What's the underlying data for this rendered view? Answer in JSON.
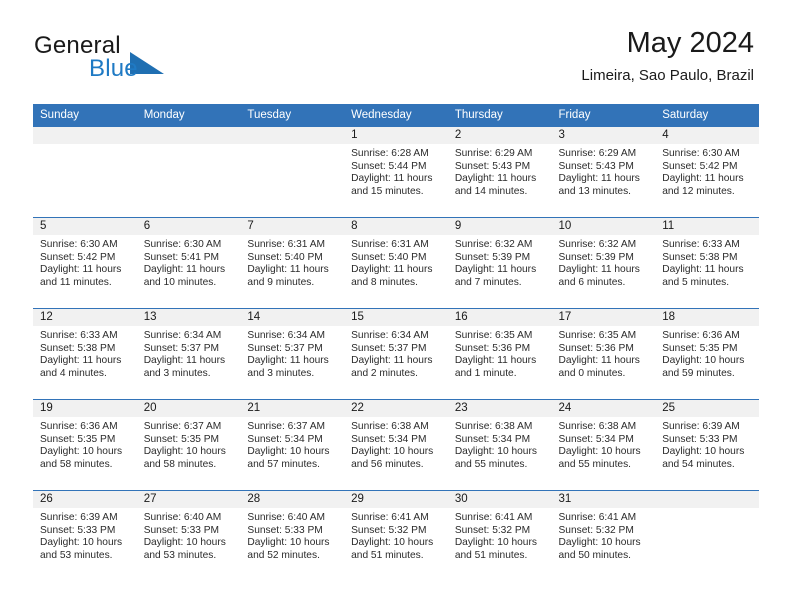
{
  "brand": {
    "name_part1": "General",
    "name_part2": "Blue",
    "logo_icon": "triangle-logo-icon"
  },
  "header": {
    "month_title": "May 2024",
    "location": "Limeira, Sao Paulo, Brazil"
  },
  "colors": {
    "header_blue": "#3273b8",
    "brand_blue": "#1f7ac4",
    "date_strip_gray": "#f1f1f1",
    "text": "#1a1a1a"
  },
  "weekday_headers": [
    "Sunday",
    "Monday",
    "Tuesday",
    "Wednesday",
    "Thursday",
    "Friday",
    "Saturday"
  ],
  "weeks": [
    [
      {
        "date": "",
        "empty": true,
        "sunrise": "",
        "sunset": "",
        "daylight_line1": "",
        "daylight_line2": ""
      },
      {
        "date": "",
        "empty": true,
        "sunrise": "",
        "sunset": "",
        "daylight_line1": "",
        "daylight_line2": ""
      },
      {
        "date": "",
        "empty": true,
        "sunrise": "",
        "sunset": "",
        "daylight_line1": "",
        "daylight_line2": ""
      },
      {
        "date": "1",
        "empty": false,
        "sunrise": "Sunrise: 6:28 AM",
        "sunset": "Sunset: 5:44 PM",
        "daylight_line1": "Daylight: 11 hours",
        "daylight_line2": "and 15 minutes."
      },
      {
        "date": "2",
        "empty": false,
        "sunrise": "Sunrise: 6:29 AM",
        "sunset": "Sunset: 5:43 PM",
        "daylight_line1": "Daylight: 11 hours",
        "daylight_line2": "and 14 minutes."
      },
      {
        "date": "3",
        "empty": false,
        "sunrise": "Sunrise: 6:29 AM",
        "sunset": "Sunset: 5:43 PM",
        "daylight_line1": "Daylight: 11 hours",
        "daylight_line2": "and 13 minutes."
      },
      {
        "date": "4",
        "empty": false,
        "sunrise": "Sunrise: 6:30 AM",
        "sunset": "Sunset: 5:42 PM",
        "daylight_line1": "Daylight: 11 hours",
        "daylight_line2": "and 12 minutes."
      }
    ],
    [
      {
        "date": "5",
        "empty": false,
        "sunrise": "Sunrise: 6:30 AM",
        "sunset": "Sunset: 5:42 PM",
        "daylight_line1": "Daylight: 11 hours",
        "daylight_line2": "and 11 minutes."
      },
      {
        "date": "6",
        "empty": false,
        "sunrise": "Sunrise: 6:30 AM",
        "sunset": "Sunset: 5:41 PM",
        "daylight_line1": "Daylight: 11 hours",
        "daylight_line2": "and 10 minutes."
      },
      {
        "date": "7",
        "empty": false,
        "sunrise": "Sunrise: 6:31 AM",
        "sunset": "Sunset: 5:40 PM",
        "daylight_line1": "Daylight: 11 hours",
        "daylight_line2": "and 9 minutes."
      },
      {
        "date": "8",
        "empty": false,
        "sunrise": "Sunrise: 6:31 AM",
        "sunset": "Sunset: 5:40 PM",
        "daylight_line1": "Daylight: 11 hours",
        "daylight_line2": "and 8 minutes."
      },
      {
        "date": "9",
        "empty": false,
        "sunrise": "Sunrise: 6:32 AM",
        "sunset": "Sunset: 5:39 PM",
        "daylight_line1": "Daylight: 11 hours",
        "daylight_line2": "and 7 minutes."
      },
      {
        "date": "10",
        "empty": false,
        "sunrise": "Sunrise: 6:32 AM",
        "sunset": "Sunset: 5:39 PM",
        "daylight_line1": "Daylight: 11 hours",
        "daylight_line2": "and 6 minutes."
      },
      {
        "date": "11",
        "empty": false,
        "sunrise": "Sunrise: 6:33 AM",
        "sunset": "Sunset: 5:38 PM",
        "daylight_line1": "Daylight: 11 hours",
        "daylight_line2": "and 5 minutes."
      }
    ],
    [
      {
        "date": "12",
        "empty": false,
        "sunrise": "Sunrise: 6:33 AM",
        "sunset": "Sunset: 5:38 PM",
        "daylight_line1": "Daylight: 11 hours",
        "daylight_line2": "and 4 minutes."
      },
      {
        "date": "13",
        "empty": false,
        "sunrise": "Sunrise: 6:34 AM",
        "sunset": "Sunset: 5:37 PM",
        "daylight_line1": "Daylight: 11 hours",
        "daylight_line2": "and 3 minutes."
      },
      {
        "date": "14",
        "empty": false,
        "sunrise": "Sunrise: 6:34 AM",
        "sunset": "Sunset: 5:37 PM",
        "daylight_line1": "Daylight: 11 hours",
        "daylight_line2": "and 3 minutes."
      },
      {
        "date": "15",
        "empty": false,
        "sunrise": "Sunrise: 6:34 AM",
        "sunset": "Sunset: 5:37 PM",
        "daylight_line1": "Daylight: 11 hours",
        "daylight_line2": "and 2 minutes."
      },
      {
        "date": "16",
        "empty": false,
        "sunrise": "Sunrise: 6:35 AM",
        "sunset": "Sunset: 5:36 PM",
        "daylight_line1": "Daylight: 11 hours",
        "daylight_line2": "and 1 minute."
      },
      {
        "date": "17",
        "empty": false,
        "sunrise": "Sunrise: 6:35 AM",
        "sunset": "Sunset: 5:36 PM",
        "daylight_line1": "Daylight: 11 hours",
        "daylight_line2": "and 0 minutes."
      },
      {
        "date": "18",
        "empty": false,
        "sunrise": "Sunrise: 6:36 AM",
        "sunset": "Sunset: 5:35 PM",
        "daylight_line1": "Daylight: 10 hours",
        "daylight_line2": "and 59 minutes."
      }
    ],
    [
      {
        "date": "19",
        "empty": false,
        "sunrise": "Sunrise: 6:36 AM",
        "sunset": "Sunset: 5:35 PM",
        "daylight_line1": "Daylight: 10 hours",
        "daylight_line2": "and 58 minutes."
      },
      {
        "date": "20",
        "empty": false,
        "sunrise": "Sunrise: 6:37 AM",
        "sunset": "Sunset: 5:35 PM",
        "daylight_line1": "Daylight: 10 hours",
        "daylight_line2": "and 58 minutes."
      },
      {
        "date": "21",
        "empty": false,
        "sunrise": "Sunrise: 6:37 AM",
        "sunset": "Sunset: 5:34 PM",
        "daylight_line1": "Daylight: 10 hours",
        "daylight_line2": "and 57 minutes."
      },
      {
        "date": "22",
        "empty": false,
        "sunrise": "Sunrise: 6:38 AM",
        "sunset": "Sunset: 5:34 PM",
        "daylight_line1": "Daylight: 10 hours",
        "daylight_line2": "and 56 minutes."
      },
      {
        "date": "23",
        "empty": false,
        "sunrise": "Sunrise: 6:38 AM",
        "sunset": "Sunset: 5:34 PM",
        "daylight_line1": "Daylight: 10 hours",
        "daylight_line2": "and 55 minutes."
      },
      {
        "date": "24",
        "empty": false,
        "sunrise": "Sunrise: 6:38 AM",
        "sunset": "Sunset: 5:34 PM",
        "daylight_line1": "Daylight: 10 hours",
        "daylight_line2": "and 55 minutes."
      },
      {
        "date": "25",
        "empty": false,
        "sunrise": "Sunrise: 6:39 AM",
        "sunset": "Sunset: 5:33 PM",
        "daylight_line1": "Daylight: 10 hours",
        "daylight_line2": "and 54 minutes."
      }
    ],
    [
      {
        "date": "26",
        "empty": false,
        "sunrise": "Sunrise: 6:39 AM",
        "sunset": "Sunset: 5:33 PM",
        "daylight_line1": "Daylight: 10 hours",
        "daylight_line2": "and 53 minutes."
      },
      {
        "date": "27",
        "empty": false,
        "sunrise": "Sunrise: 6:40 AM",
        "sunset": "Sunset: 5:33 PM",
        "daylight_line1": "Daylight: 10 hours",
        "daylight_line2": "and 53 minutes."
      },
      {
        "date": "28",
        "empty": false,
        "sunrise": "Sunrise: 6:40 AM",
        "sunset": "Sunset: 5:33 PM",
        "daylight_line1": "Daylight: 10 hours",
        "daylight_line2": "and 52 minutes."
      },
      {
        "date": "29",
        "empty": false,
        "sunrise": "Sunrise: 6:41 AM",
        "sunset": "Sunset: 5:32 PM",
        "daylight_line1": "Daylight: 10 hours",
        "daylight_line2": "and 51 minutes."
      },
      {
        "date": "30",
        "empty": false,
        "sunrise": "Sunrise: 6:41 AM",
        "sunset": "Sunset: 5:32 PM",
        "daylight_line1": "Daylight: 10 hours",
        "daylight_line2": "and 51 minutes."
      },
      {
        "date": "31",
        "empty": false,
        "sunrise": "Sunrise: 6:41 AM",
        "sunset": "Sunset: 5:32 PM",
        "daylight_line1": "Daylight: 10 hours",
        "daylight_line2": "and 50 minutes."
      },
      {
        "date": "",
        "empty": true,
        "sunrise": "",
        "sunset": "",
        "daylight_line1": "",
        "daylight_line2": ""
      }
    ]
  ]
}
